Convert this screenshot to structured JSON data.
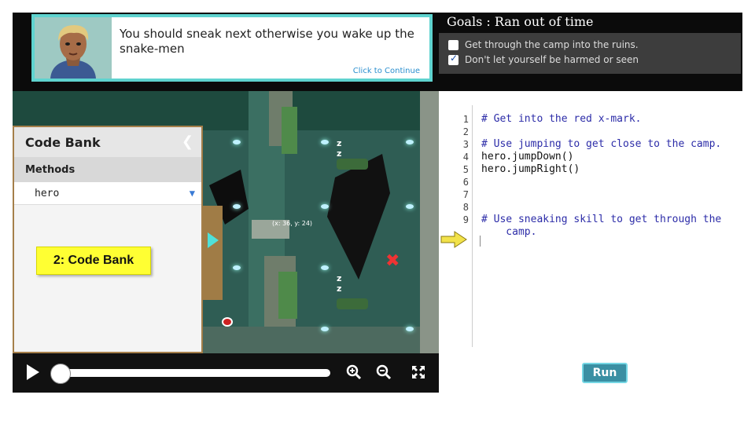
{
  "dialog": {
    "message": "You should sneak next otherwise you wake up the snake-men",
    "continue_label": "Click to Continue"
  },
  "goals": {
    "title": "Goals : Ran out of time",
    "items": [
      {
        "label": "Get through the camp into the ruins.",
        "checked": false
      },
      {
        "label": "Don't let yourself be harmed or seen",
        "checked": true
      }
    ]
  },
  "game": {
    "coord_label": "(x: 36, y: 24)",
    "sleep_marks": [
      "z\nz",
      "z\nz"
    ]
  },
  "code_bank": {
    "title": "Code Bank",
    "section": "Methods",
    "selected": "hero",
    "annotation": "2: Code Bank"
  },
  "editor": {
    "lines": [
      {
        "n": "1",
        "text": "# Get into the red x-mark.",
        "kind": "comment"
      },
      {
        "n": "2",
        "text": "",
        "kind": "plain"
      },
      {
        "n": "3",
        "text": "# Use jumping to get close to the camp.",
        "kind": "comment"
      },
      {
        "n": "4",
        "text": "hero.jumpDown()",
        "kind": "plain"
      },
      {
        "n": "5",
        "text": "hero.jumpRight()",
        "kind": "plain"
      },
      {
        "n": "6",
        "text": "",
        "kind": "plain"
      },
      {
        "n": "7",
        "text": "",
        "kind": "plain"
      },
      {
        "n": "8",
        "text": "",
        "kind": "plain"
      },
      {
        "n": "9",
        "text": "# Use sneaking skill to get through the",
        "kind": "comment"
      },
      {
        "n": "",
        "text": "    camp.",
        "kind": "comment"
      }
    ],
    "run_label": "Run"
  },
  "colors": {
    "accent": "#5fd3cf",
    "run_button": "#3a8fa3",
    "comment_text": "#2c2ca8",
    "note_yellow": "#ffff33"
  },
  "icons": [
    "play-icon",
    "zoom-in-icon",
    "zoom-out-icon",
    "fullscreen-icon",
    "chevron-left-icon",
    "chevron-down-icon",
    "red-x-mark-icon",
    "pointer-arrow-icon"
  ]
}
